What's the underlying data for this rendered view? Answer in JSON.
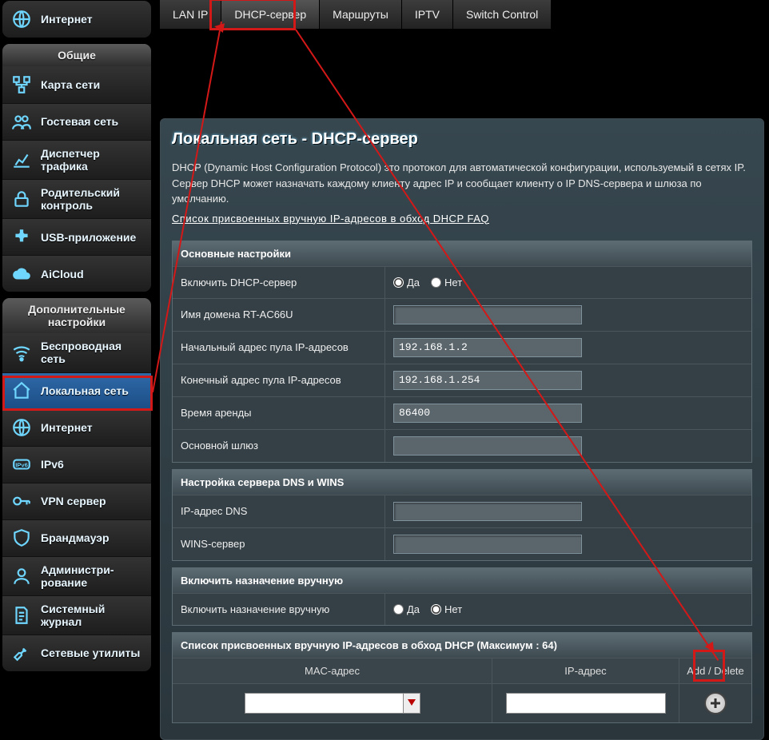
{
  "sidebar": {
    "internet_top": "Интернет",
    "group_general": "Общие",
    "items_general": [
      {
        "label": "Карта сети"
      },
      {
        "label": "Гостевая сеть"
      },
      {
        "label": "Диспетчер трафика"
      },
      {
        "label": "Родительский контроль"
      },
      {
        "label": "USB-приложение"
      },
      {
        "label": "AiCloud"
      }
    ],
    "group_advanced": "Дополнительные настройки",
    "items_advanced": [
      {
        "label": "Беспроводная сеть"
      },
      {
        "label": "Локальная сеть"
      },
      {
        "label": "Интернет"
      },
      {
        "label": "IPv6"
      },
      {
        "label": "VPN сервер"
      },
      {
        "label": "Брандмауэр"
      },
      {
        "label": "Администри-рование"
      },
      {
        "label": "Системный журнал"
      },
      {
        "label": "Сетевые утилиты"
      }
    ]
  },
  "tabs": [
    {
      "label": "LAN IP"
    },
    {
      "label": "DHCP-сервер"
    },
    {
      "label": "Маршруты"
    },
    {
      "label": "IPTV"
    },
    {
      "label": "Switch Control"
    }
  ],
  "page": {
    "title": "Локальная сеть - DHCP-сервер",
    "desc": "DHCP (Dynamic Host Configuration Protocol) это протокол для автоматической конфигурации, используемый в сетях IP. Сервер DHCP может назначать каждому клиенту адрес IP и сообщает клиенту о IP DNS-сервера и шлюза по умолчанию.",
    "faq": "Список присвоенных вручную IP-адресов в обход DHCP FAQ"
  },
  "sections": {
    "basic": {
      "title": "Основные настройки",
      "enable_label": "Включить DHCP-сервер",
      "yes": "Да",
      "no": "Нет",
      "domain_label": "Имя домена RT-AC66U",
      "domain_value": "",
      "pool_start_label": "Начальный адрес пула IP-адресов",
      "pool_start_value": "192.168.1.2",
      "pool_end_label": "Конечный адрес пула IP-адресов",
      "pool_end_value": "192.168.1.254",
      "lease_label": "Время аренды",
      "lease_value": "86400",
      "gateway_label": "Основной шлюз",
      "gateway_value": ""
    },
    "dnswins": {
      "title": "Настройка сервера DNS и WINS",
      "dns_label": "IP-адрес DNS",
      "dns_value": "",
      "wins_label": "WINS-сервер",
      "wins_value": ""
    },
    "manual": {
      "title": "Включить назначение вручную",
      "manual_label": "Включить назначение вручную",
      "yes": "Да",
      "no": "Нет"
    },
    "static": {
      "title": "Список присвоенных вручную IP-адресов в обход DHCP (Максимум : 64)",
      "col_mac": "MAC-адрес",
      "col_ip": "IP-адрес",
      "col_add": "Add / Delete"
    }
  }
}
